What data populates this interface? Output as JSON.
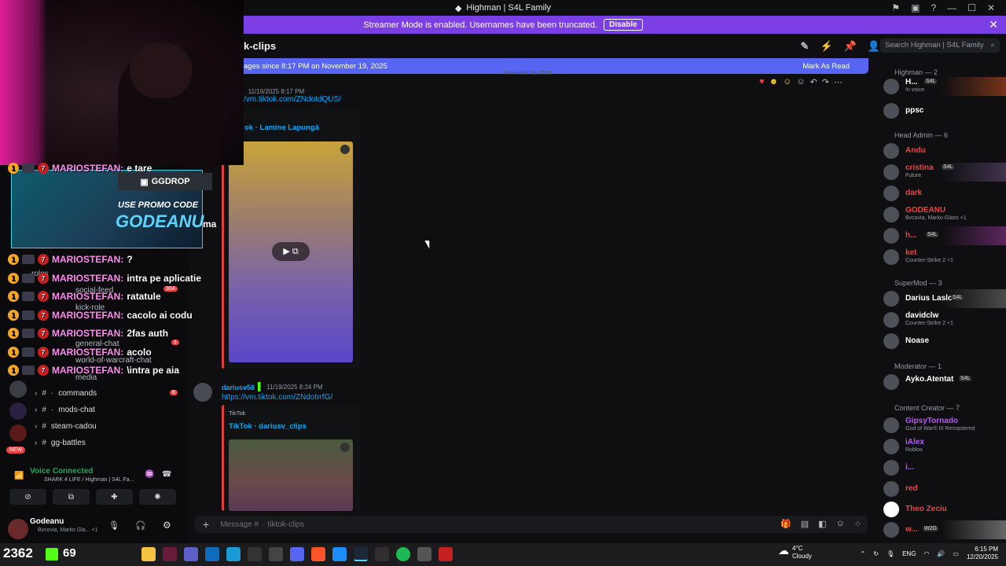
{
  "window": {
    "title": "Highman | S4L Family"
  },
  "banner": {
    "text": "Streamer Mode is enabled. Usernames have been truncated.",
    "disable_label": "Disable"
  },
  "channel": {
    "name": "k-clips",
    "search_placeholder": "Search Highman | S4L Family"
  },
  "new_messages": {
    "text": "ages since 8:17 PM on November 19, 2025",
    "mark_read": "Mark As Read",
    "divider": "November 19, 2025"
  },
  "messages": [
    {
      "time": "11/19/2025 8:17 PM",
      "link": "/vm.tiktok.com/ZNdotdQUS/",
      "embed_title": "ok · Lamine Lapungă"
    },
    {
      "author": "dariusv56",
      "time": "11/19/2025 8:24 PM",
      "link": "https://vm.tiktok.com/ZNdotrrfG/",
      "embed_provider": "TikTok",
      "embed_title": "TikTok · dariusv_clips"
    }
  ],
  "stream_chat": [
    {
      "user": "MARIOSTEFAN:",
      "text": "e tare"
    },
    {
      "user": "MARIOSTEFAN:",
      "text": "?"
    },
    {
      "user": "MARIOSTEFAN:",
      "text": "intra pe aplicatie"
    },
    {
      "user": "MARIOSTEFAN:",
      "text": "ratatule"
    },
    {
      "user": "MARIOSTEFAN:",
      "text": "cacolo ai codu"
    },
    {
      "user": "MARIOSTEFAN:",
      "text": "2fas auth"
    },
    {
      "user": "MARIOSTEFAN:",
      "text": "acolo"
    },
    {
      "user": "MARIOSTEFAN:",
      "text": "\\intra pe aia"
    }
  ],
  "promo": {
    "brand": "GGDROP",
    "line1": "USE PROMO CODE",
    "code": "GODEANU",
    "fragment": "ma"
  },
  "channels": [
    {
      "name": "roles"
    },
    {
      "name": "social-feed",
      "badge": "304"
    },
    {
      "name": "kick-role"
    },
    {
      "name": "general-chat",
      "badge": "1"
    },
    {
      "name": "world-of-warcraft-chat"
    },
    {
      "name": "media"
    },
    {
      "name": "commands",
      "badge": "8"
    },
    {
      "name": "mods-chat"
    },
    {
      "name": "steam-cadou"
    },
    {
      "name": "gg-battles"
    }
  ],
  "voice": {
    "status": "Voice Connected",
    "channel": "SHARK 4 LIFE / Highman | S4L Fa..."
  },
  "user": {
    "name": "Godeanu",
    "status": "Bvcovia, Marko Gla... +1"
  },
  "composer": {
    "placeholder": "Message #",
    "channel": "tiktok-clips"
  },
  "members": {
    "categories": [
      "Highman — 2",
      "Head Admin — 6",
      "SuperMod — 3",
      "Moderator — 1",
      "Content Creator — 7"
    ],
    "list": [
      {
        "name": "H...",
        "tag": "S4L",
        "status": "In voice",
        "color": "#ffffff"
      },
      {
        "name": "ppsc",
        "color": "#ffffff"
      },
      {
        "name": "Andu",
        "color": "#ed4245"
      },
      {
        "name": "cristina",
        "tag": "S4L",
        "status": "Future",
        "color": "#ed4245"
      },
      {
        "name": "dark",
        "color": "#ed4245"
      },
      {
        "name": "GODEANU",
        "status": "Bvcovia, Marko Glass +1",
        "color": "#ed4245"
      },
      {
        "name": "h...",
        "tag": "S4L",
        "color": "#ed4245"
      },
      {
        "name": "ket",
        "status": "Counter-Strike 2 +1",
        "color": "#ed4245"
      },
      {
        "name": "Darius Laslo",
        "tag": "S4L",
        "color": "#ffffff"
      },
      {
        "name": "davidclw",
        "status": "Counter-Strike 2 +1",
        "color": "#ffffff"
      },
      {
        "name": "Noase",
        "color": "#ffffff"
      },
      {
        "name": "Ayko.Atentat",
        "tag": "S4L",
        "color": "#ffffff"
      },
      {
        "name": "GipsyTornado",
        "status": "God of War® III Remastered",
        "color": "#b45bff"
      },
      {
        "name": "iAlex",
        "status": "Roblox",
        "color": "#b45bff"
      },
      {
        "name": "i...",
        "color": "#b45bff"
      },
      {
        "name": "red",
        "color": "#ed4245"
      },
      {
        "name": "Theo Zeciu",
        "color": "#ed4245"
      },
      {
        "name": "w...",
        "tag": "W2G",
        "color": "#ed4245"
      }
    ]
  },
  "taskbar": {
    "counter": "2362",
    "kick": "69",
    "weather_temp": "4°C",
    "weather": "Cloudy",
    "lang": "ENG",
    "time": "6:15 PM",
    "date": "12/20/2025"
  }
}
